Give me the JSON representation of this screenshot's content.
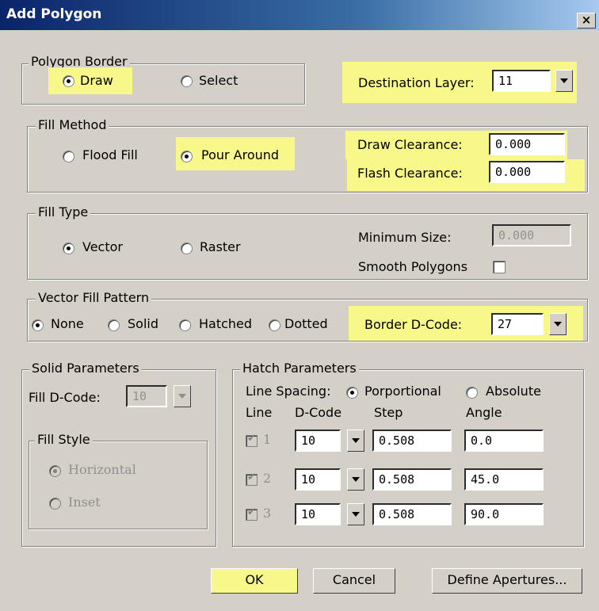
{
  "window": {
    "title": "Add Polygon",
    "close": "×"
  },
  "polygon_border": {
    "legend": "Polygon Border",
    "draw": "Draw",
    "select": "Select",
    "dest_label": "Destination Layer:",
    "dest_value": "11"
  },
  "fill_method": {
    "legend": "Fill Method",
    "flood": "Flood Fill",
    "pour": "Pour Around",
    "draw_clear_label": "Draw Clearance:",
    "draw_clear_value": "0.000",
    "flash_clear_label": "Flash Clearance:",
    "flash_clear_value": "0.000"
  },
  "fill_type": {
    "legend": "Fill Type",
    "vector": "Vector",
    "raster": "Raster",
    "min_size_label": "Minimum Size:",
    "min_size_value": "0.000",
    "smooth_label": "Smooth Polygons"
  },
  "vector_fill": {
    "legend": "Vector Fill Pattern",
    "none": "None",
    "solid": "Solid",
    "hatched": "Hatched",
    "dotted": "Dotted",
    "border_label": "Border D-Code:",
    "border_value": "27"
  },
  "solid_params": {
    "legend": "Solid Parameters",
    "dcode_label": "Fill D-Code:",
    "dcode_value": "10",
    "style_legend": "Fill Style",
    "horizontal": "Horizontal",
    "inset": "Inset"
  },
  "hatch": {
    "legend": "Hatch Parameters",
    "spacing_label": "Line Spacing:",
    "proportional": "Porportional",
    "absolute": "Absolute",
    "headers": {
      "line": "Line",
      "dcode": "D-Code",
      "step": "Step",
      "angle": "Angle"
    },
    "rows": [
      {
        "line": "1",
        "dcode": "10",
        "step": "0.508",
        "angle": "0.0"
      },
      {
        "line": "2",
        "dcode": "10",
        "step": "0.508",
        "angle": "45.0"
      },
      {
        "line": "3",
        "dcode": "10",
        "step": "0.508",
        "angle": "90.0"
      }
    ]
  },
  "buttons": {
    "ok": "OK",
    "cancel": "Cancel",
    "define": "Define Apertures..."
  },
  "colors": {
    "highlight": "#f7f78a",
    "titlebar": "#0a246a",
    "face": "#d4d0c8"
  }
}
